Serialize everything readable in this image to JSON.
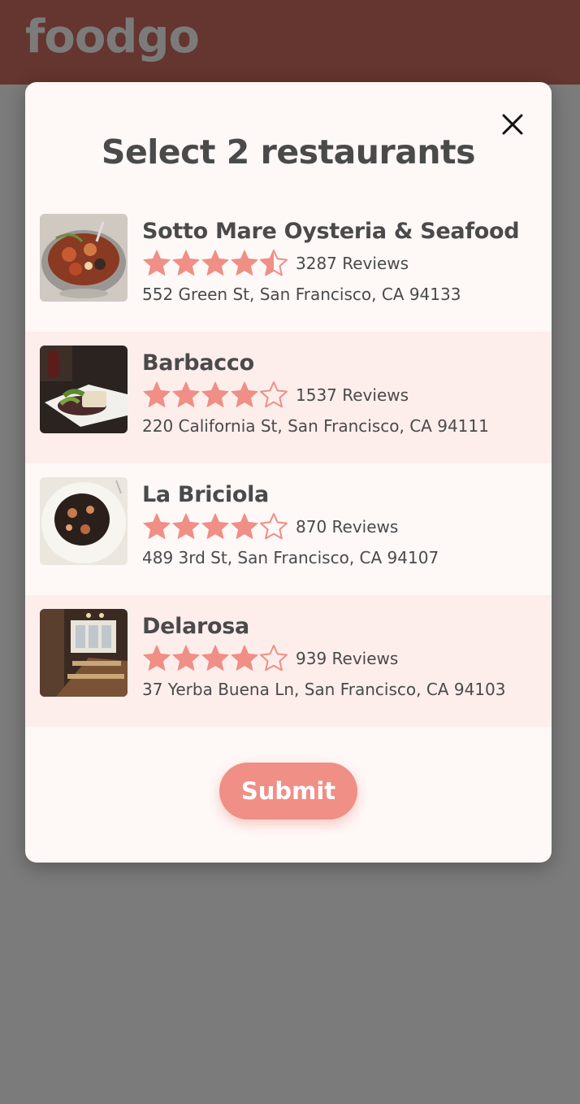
{
  "app": {
    "brand": "foodgo"
  },
  "colors": {
    "header": "#c2665a",
    "accent": "#ef8f85",
    "modal_bg": "#fef8f7",
    "row_alt_bg": "#fdeeec",
    "text": "#4a4a4a"
  },
  "modal": {
    "title": "Select 2 restaurants",
    "close_icon": "close-icon",
    "submit_label": "Submit",
    "restaurants": [
      {
        "name": "Sotto Mare Oysteria & Seafood",
        "rating": 4.5,
        "reviews": "3287 Reviews",
        "address": "552 Green St, San Francisco, CA 94133",
        "image": "seafood-stew-photo"
      },
      {
        "name": "Barbacco",
        "rating": 4,
        "reviews": "1537 Reviews",
        "address": "220 California St, San Francisco, CA 94111",
        "image": "plated-dish-photo"
      },
      {
        "name": "La Briciola",
        "rating": 4,
        "reviews": "870 Reviews",
        "address": "489 3rd St, San Francisco, CA 94107",
        "image": "squid-ink-pasta-photo"
      },
      {
        "name": "Delarosa",
        "rating": 4,
        "reviews": "939 Reviews",
        "address": "37 Yerba Buena Ln, San Francisco, CA 94103",
        "image": "restaurant-interior-photo"
      }
    ]
  }
}
